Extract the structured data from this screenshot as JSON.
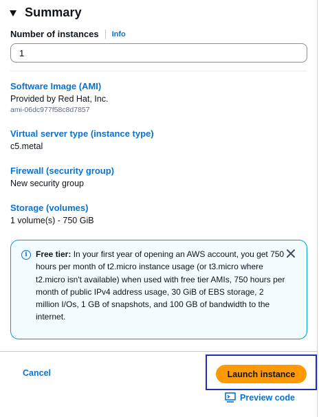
{
  "summary": {
    "title": "Summary"
  },
  "instances": {
    "label": "Number of instances",
    "info": "Info",
    "value": "1"
  },
  "sections": {
    "ami": {
      "title": "Software Image (AMI)",
      "value": "Provided by Red Hat, Inc.",
      "sub": "ami-06dc977f58c8d7857"
    },
    "instance_type": {
      "title": "Virtual server type (instance type)",
      "value": "c5.metal"
    },
    "firewall": {
      "title": "Firewall (security group)",
      "value": "New security group"
    },
    "storage": {
      "title": "Storage (volumes)",
      "value": "1 volume(s) - 750 GiB"
    }
  },
  "alert": {
    "heading": "Free tier:",
    "body": "In your first year of opening an AWS account, you get 750 hours per month of t2.micro instance usage (or t3.micro where t2.micro isn't available) when used with free tier AMIs, 750 hours per month of public IPv4 address usage, 30 GiB of EBS storage, 2 million I/Os, 1 GB of snapshots, and 100 GB of bandwidth to the internet."
  },
  "footer": {
    "cancel": "Cancel",
    "launch": "Launch instance",
    "preview": "Preview code"
  },
  "colors": {
    "link": "#0972d3",
    "primary_button": "#ff9900",
    "alert_bg": "#f2fbfd",
    "alert_border": "#00a1c9",
    "highlight": "#1a2eb8"
  }
}
